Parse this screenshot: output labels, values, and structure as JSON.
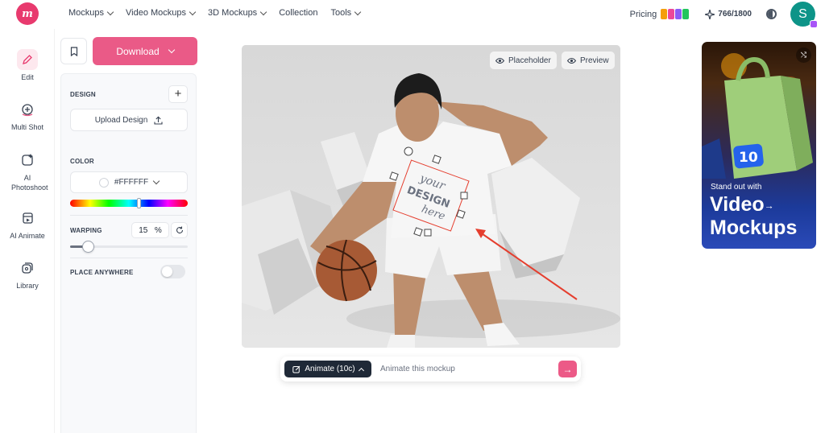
{
  "nav": {
    "items": [
      {
        "label": "Mockups",
        "has_chevron": true
      },
      {
        "label": "Video Mockups",
        "has_chevron": true
      },
      {
        "label": "3D Mockups",
        "has_chevron": true
      },
      {
        "label": "Collection",
        "has_chevron": false
      },
      {
        "label": "Tools",
        "has_chevron": true
      }
    ],
    "pricing_label": "Pricing",
    "credits": "766/1800",
    "avatar_initial": "S",
    "badge_colors": [
      "#f59e0b",
      "#ec4899",
      "#8b5cf6",
      "#22c55e"
    ]
  },
  "sidebar": {
    "items": [
      {
        "label": "Edit",
        "icon": "edit-icon",
        "active": true
      },
      {
        "label": "Multi Shot",
        "icon": "multi-shot-icon",
        "active": false
      },
      {
        "label": "AI Photoshoot",
        "icon": "ai-photoshoot-icon",
        "active": false
      },
      {
        "label": "AI Animate",
        "icon": "ai-animate-icon",
        "active": false
      },
      {
        "label": "Library",
        "icon": "library-icon",
        "active": false
      }
    ]
  },
  "toolbar": {
    "download_label": "Download"
  },
  "panel": {
    "design_label": "DESIGN",
    "upload_label": "Upload Design",
    "color_label": "COLOR",
    "color_value": "#FFFFFF",
    "hue_position": 0.58,
    "warping_label": "WARPING",
    "warping_value": "15",
    "warping_unit": "%",
    "warping_fraction": 0.15,
    "place_anywhere_label": "PLACE ANYWHERE",
    "place_anywhere_on": false
  },
  "canvas": {
    "placeholder_label": "Placeholder",
    "preview_label": "Preview",
    "design_text": {
      "line1": "your",
      "line2": "DESIGN",
      "line3": "here"
    }
  },
  "animate": {
    "button_label": "Animate (10c)",
    "input_placeholder": "Animate this mockup"
  },
  "ad": {
    "subtitle": "Stand out with",
    "title_line1": "Video",
    "title_line2": "Mockups",
    "badge_text": "10"
  },
  "colors": {
    "brand": "#ea5a87",
    "logo": "#e83a6e",
    "avatar": "#0d9488",
    "arrow": "#e53e2e"
  }
}
